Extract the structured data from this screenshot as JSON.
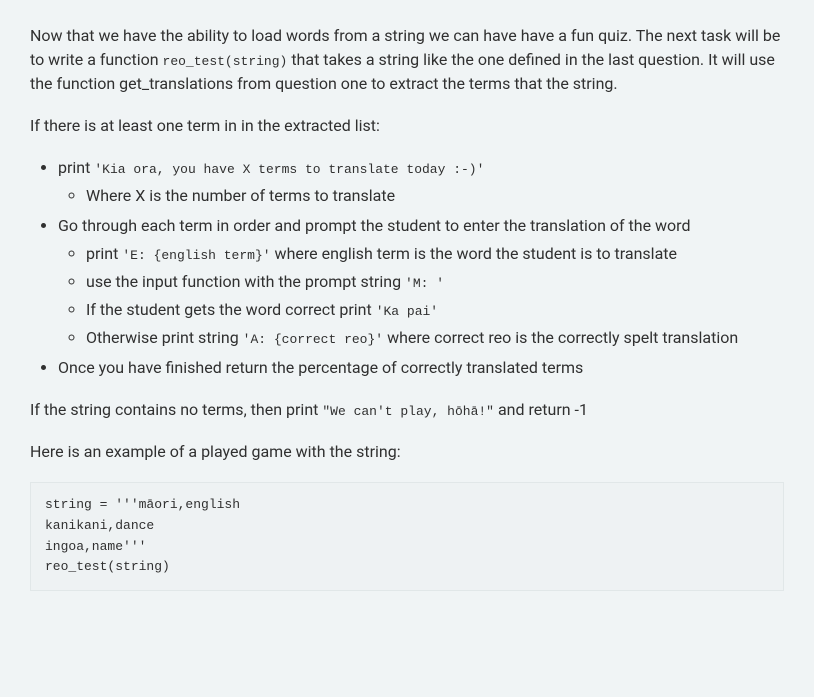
{
  "intro": {
    "part1": "Now that we have the ability to load words from a string we can have have a fun quiz. The next task will be to write a function ",
    "code1": "reo_test(string)",
    "part2": " that takes a string like the one defined in the last question. It will use the function get_translations from question one to extract the terms that the string."
  },
  "cond_intro": "If there is at least one term in in the extracted list:",
  "bullets": {
    "b1_pre": "print ",
    "b1_code": "'Kia ora, you have X terms to translate today :-)'",
    "b1_sub1": "Where X is the number of terms to translate",
    "b2": "Go through each term in order and prompt the student to enter the translation of the word",
    "b2_sub1_pre": "print ",
    "b2_sub1_code": "'E: {english term}'",
    "b2_sub1_post": " where english term is the word the student is to translate",
    "b2_sub2_pre": "use the input function with the prompt string ",
    "b2_sub2_code": "'M: '",
    "b2_sub3_pre": "If the student gets the word correct print ",
    "b2_sub3_code": "'Ka pai'",
    "b2_sub4_pre": "Otherwise print string ",
    "b2_sub4_code": "'A: {correct reo}'",
    "b2_sub4_post": " where correct reo is the correctly spelt translation",
    "b3": "Once you have finished return the percentage of correctly translated terms"
  },
  "no_terms": {
    "pre": "If the string contains no terms, then print ",
    "code": "\"We can't play, hōhā!\"",
    "post": " and return -1"
  },
  "example_intro": "Here is an example of a played game with the string:",
  "code_block": "string = '''māori,english\nkanikani,dance\ningoa,name'''\nreo_test(string)"
}
